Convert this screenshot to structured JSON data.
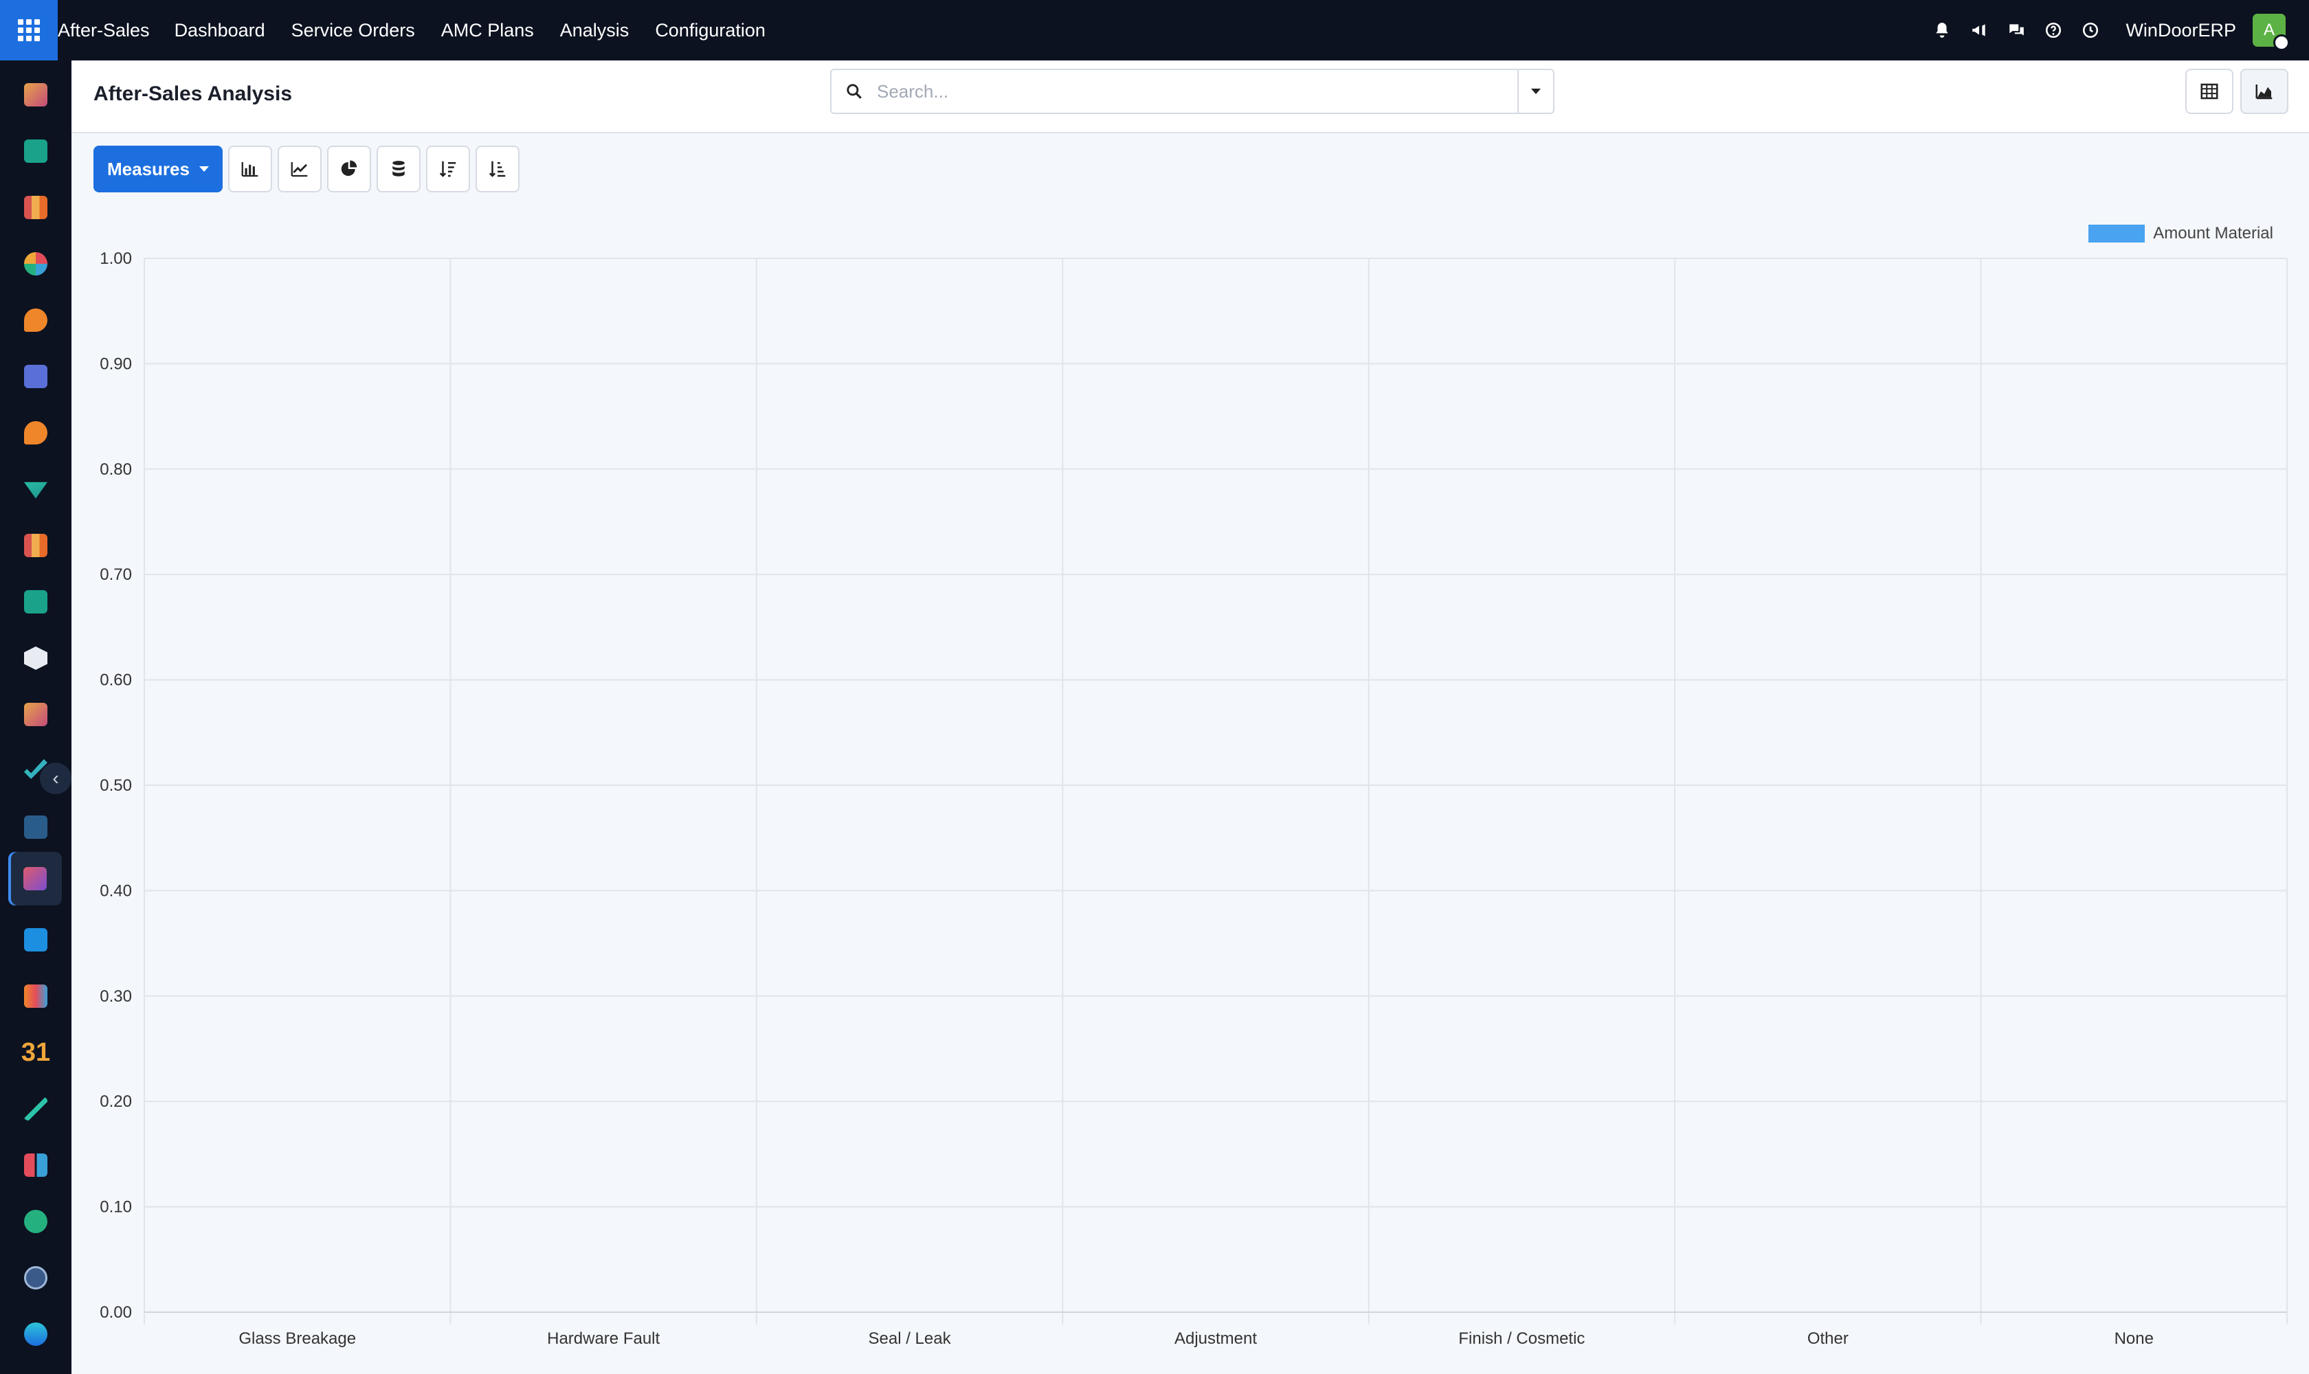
{
  "topbar": {
    "app_name": "After-Sales",
    "menu": [
      "Dashboard",
      "Service Orders",
      "AMC Plans",
      "Analysis",
      "Configuration"
    ],
    "company": "WinDoorERP",
    "avatar_letter": "A",
    "icons": [
      "bell-icon",
      "megaphone-icon",
      "chat-icon",
      "help-icon",
      "clock-icon"
    ]
  },
  "sidebar": {
    "apps": [
      "app-1",
      "app-2",
      "app-3",
      "app-4",
      "app-5",
      "app-6",
      "app-7",
      "app-8",
      "app-9",
      "app-10",
      "app-11",
      "app-12",
      "app-13",
      "app-14",
      "after-sales",
      "app-16",
      "app-17",
      "calendar-app",
      "app-19",
      "app-20",
      "whatsapp-app",
      "app-22",
      "app-23"
    ],
    "active": "after-sales"
  },
  "control": {
    "title": "After-Sales Analysis",
    "search_placeholder": "Search..."
  },
  "toolbar": {
    "measures_label": "Measures",
    "buttons": [
      "bar-chart",
      "line-chart",
      "pie-chart",
      "stacked",
      "descending",
      "ascending"
    ]
  },
  "colors": {
    "accent": "#1d6fe0",
    "series": "#4aa3f0",
    "navbar": "#0c1220"
  },
  "chart_data": {
    "type": "bar",
    "title": "",
    "xlabel": "",
    "ylabel": "",
    "categories": [
      "Glass Breakage",
      "Hardware Fault",
      "Seal / Leak",
      "Adjustment",
      "Finish / Cosmetic",
      "Other",
      "None"
    ],
    "series": [
      {
        "name": "Amount Material",
        "values": [
          0,
          0,
          0,
          0,
          0,
          0,
          0
        ]
      }
    ],
    "ylim": [
      0,
      1
    ],
    "yticks": [
      "0.00",
      "0.10",
      "0.20",
      "0.30",
      "0.40",
      "0.50",
      "0.60",
      "0.70",
      "0.80",
      "0.90",
      "1.00"
    ],
    "grid": true,
    "legend": "top-right"
  }
}
